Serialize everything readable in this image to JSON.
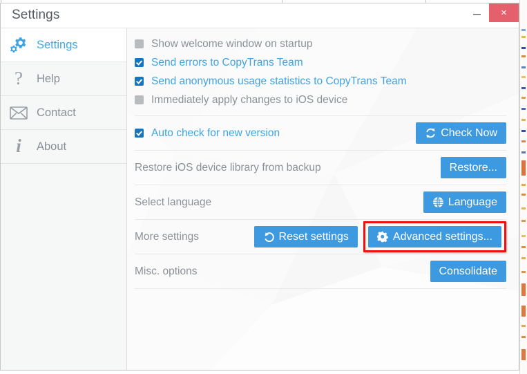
{
  "window": {
    "title": "Settings",
    "minimize_label": "minimize",
    "close_label": "×",
    "close_color": "#e4606d"
  },
  "sidebar": {
    "items": [
      {
        "label": "Settings",
        "icon": "gears-icon",
        "active": true
      },
      {
        "label": "Help",
        "icon": "question-mark-icon",
        "active": false
      },
      {
        "label": "Contact",
        "icon": "envelope-icon",
        "active": false
      },
      {
        "label": "About",
        "icon": "info-icon",
        "active": false
      }
    ]
  },
  "main": {
    "checkboxes": [
      {
        "label": "Show welcome window on startup",
        "checked": false
      },
      {
        "label": "Send errors to CopyTrans Team",
        "checked": true
      },
      {
        "label": "Send anonymous usage statistics to CopyTrans Team",
        "checked": true
      },
      {
        "label": "Immediately apply changes to iOS device",
        "checked": false
      }
    ],
    "rows": [
      {
        "type": "checkbox_row",
        "label": "Auto check for new version",
        "checked": true,
        "buttons": [
          {
            "label": "Check Now",
            "icon": "refresh-icon",
            "highlighted": false
          }
        ]
      },
      {
        "type": "label_row",
        "label": "Restore iOS device library from backup",
        "buttons": [
          {
            "label": "Restore...",
            "icon": "none",
            "highlighted": false
          }
        ]
      },
      {
        "type": "label_row",
        "label": "Select language",
        "buttons": [
          {
            "label": "Language",
            "icon": "globe-icon",
            "highlighted": false
          }
        ]
      },
      {
        "type": "label_row",
        "label": "More settings",
        "buttons": [
          {
            "label": "Reset settings",
            "icon": "undo-icon",
            "highlighted": false
          },
          {
            "label": "Advanced settings...",
            "icon": "gear-icon",
            "highlighted": true
          }
        ]
      },
      {
        "type": "label_row",
        "label": "Misc. options",
        "buttons": [
          {
            "label": "Consolidate",
            "icon": "none",
            "highlighted": false
          }
        ]
      }
    ]
  },
  "colors": {
    "accent_blue": "#3d9ae0",
    "link_blue": "#3ea3e3",
    "checkbox_on": "#1575bf",
    "highlight_red": "#ee1111",
    "muted_text": "#8c9197"
  }
}
